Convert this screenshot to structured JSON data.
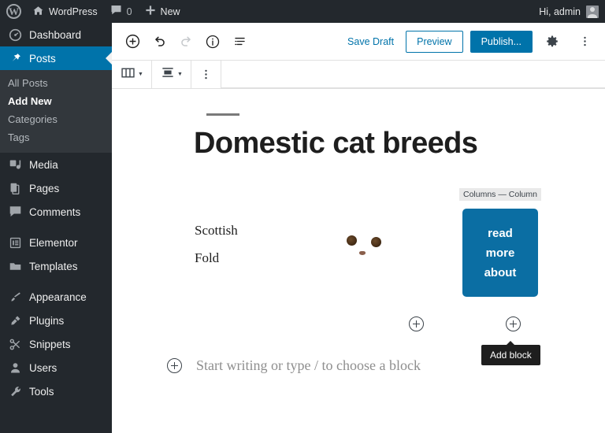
{
  "adminbar": {
    "logo_icon": "wordpress-logo-icon",
    "home_icon": "home-icon",
    "site_name": "WordPress",
    "comments_icon": "comment-icon",
    "comments_count": "0",
    "new_icon": "plus-icon",
    "new_label": "New",
    "greeting": "Hi, admin",
    "avatar_icon": "avatar-icon"
  },
  "sidebar": {
    "items": [
      {
        "label": "Dashboard",
        "icon": "dashboard-icon",
        "active": false
      },
      {
        "label": "Posts",
        "icon": "pin-icon",
        "active": true
      },
      {
        "label": "Media",
        "icon": "media-icon",
        "active": false
      },
      {
        "label": "Pages",
        "icon": "pages-icon",
        "active": false
      },
      {
        "label": "Comments",
        "icon": "comment-icon",
        "active": false
      },
      {
        "label": "Elementor",
        "icon": "elementor-icon",
        "active": false
      },
      {
        "label": "Templates",
        "icon": "folder-icon",
        "active": false
      },
      {
        "label": "Appearance",
        "icon": "brush-icon",
        "active": false
      },
      {
        "label": "Plugins",
        "icon": "plug-icon",
        "active": false
      },
      {
        "label": "Snippets",
        "icon": "scissors-icon",
        "active": false
      },
      {
        "label": "Users",
        "icon": "user-icon",
        "active": false
      },
      {
        "label": "Tools",
        "icon": "wrench-icon",
        "active": false
      }
    ],
    "posts_submenu": [
      {
        "label": "All Posts",
        "current": false
      },
      {
        "label": "Add New",
        "current": true
      },
      {
        "label": "Categories",
        "current": false
      },
      {
        "label": "Tags",
        "current": false
      }
    ]
  },
  "editor_header": {
    "add_block_icon": "plus-circle-icon",
    "undo_icon": "undo-icon",
    "redo_icon": "redo-icon",
    "info_icon": "info-icon",
    "list_view_icon": "list-view-icon",
    "save_draft_label": "Save Draft",
    "preview_label": "Preview",
    "publish_label": "Publish...",
    "settings_icon": "gear-icon",
    "more_icon": "kebab-menu-icon"
  },
  "block_toolbar": {
    "block_type_icon": "columns-icon",
    "align_icon": "align-icon",
    "more_icon": "kebab-menu-icon",
    "caret": "▼"
  },
  "canvas": {
    "post_title": "Domestic cat breeds",
    "breadcrumb": "Columns — Column",
    "column_text": "Scottish Fold",
    "image_alt_icon": "cat-photo",
    "button_lines": [
      "read",
      "more",
      "about"
    ],
    "button_color": "#0b6ea3",
    "appender_icon": "plus-circle-icon",
    "tooltip_label": "Add block",
    "paragraph_placeholder": "Start writing or type / to choose a block"
  },
  "colors": {
    "adminbar_bg": "#23282d",
    "sidebar_bg": "#23282d",
    "sidebar_active": "#0073aa",
    "submenu_bg": "#32373c",
    "accent": "#0073aa",
    "tooltip_bg": "#1e1e1e"
  }
}
